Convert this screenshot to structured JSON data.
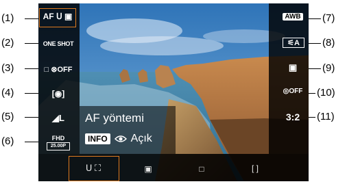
{
  "callouts": {
    "left": [
      "(1)",
      "(2)",
      "(3)",
      "(4)",
      "(5)",
      "(6)"
    ],
    "right": [
      "(7)",
      "(8)",
      "(9)",
      "(10)",
      "(11)"
    ]
  },
  "left_panel": {
    "af_method": "AF",
    "af_method_symbol": "ᑌ ▣",
    "af_operation": "ONE SHOT",
    "drive_mode": "□ ⊗OFF",
    "metering": "[◉]",
    "image_quality": "◢L",
    "movie_size_top": "FHD",
    "movie_size_bottom": "25.00P"
  },
  "right_panel": {
    "white_balance": "AWB",
    "picture_style": "A",
    "picture_style_prefix": "⚟",
    "alo": "▣",
    "lens_corr": "◎OFF",
    "aspect_ratio": "3:2"
  },
  "info_overlay": {
    "title": "AF yöntemi",
    "info_key": "INFO",
    "eye_icon": "eye-icon",
    "value": "Açık"
  },
  "bottom_bar": {
    "options": [
      "ᑌ ⛶",
      "▣",
      "□",
      "[ ]"
    ],
    "selected_index": 0
  },
  "colors": {
    "highlight": "#e07b1f",
    "panel_bg": "#000000",
    "sky": "#3b7fc0"
  }
}
